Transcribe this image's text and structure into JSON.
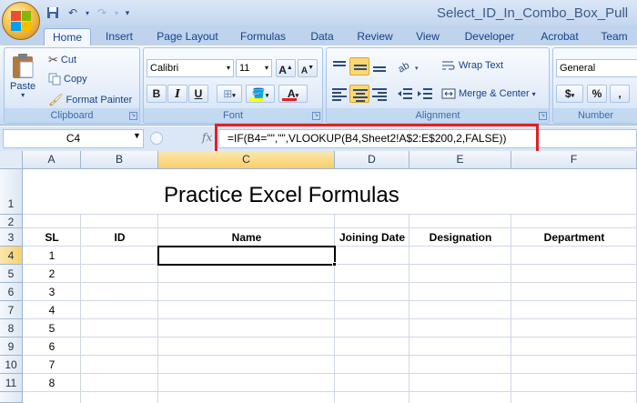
{
  "titlebar": {
    "title": "Select_ID_In_Combo_Box_Pull"
  },
  "ribbon_tabs": [
    "Home",
    "Insert",
    "Page Layout",
    "Formulas",
    "Data",
    "Review",
    "View",
    "Developer",
    "Acrobat",
    "Team"
  ],
  "clipboard": {
    "paste": "Paste",
    "cut": "Cut",
    "copy": "Copy",
    "format_painter": "Format Painter",
    "label": "Clipboard"
  },
  "font": {
    "name": "Calibri",
    "size": "11",
    "grow": "A",
    "shrink": "A",
    "bold": "B",
    "italic": "I",
    "underline": "U",
    "font_color": "A",
    "label": "Font"
  },
  "alignment": {
    "wrap_text": "Wrap Text",
    "merge_center": "Merge & Center",
    "label": "Alignment"
  },
  "number": {
    "format": "General",
    "currency": "$",
    "percent": "%",
    "comma": ",",
    "label": "Number"
  },
  "formula_bar": {
    "name_box": "C4",
    "fx": "fx",
    "formula": "=IF(B4=\"\",\"\",VLOOKUP(B4,Sheet2!A$2:E$200,2,FALSE))"
  },
  "columns": [
    "A",
    "B",
    "C",
    "D",
    "E",
    "F"
  ],
  "rows": [
    "1",
    "2",
    "3",
    "4",
    "5",
    "6",
    "7",
    "8",
    "9",
    "10",
    "11"
  ],
  "sheet": {
    "title": "Practice Excel Formulas",
    "headers": [
      "SL",
      "ID",
      "Name",
      "Joining Date",
      "Designation",
      "Department"
    ],
    "sl": [
      "1",
      "2",
      "3",
      "4",
      "5",
      "6",
      "7",
      "8"
    ]
  },
  "colors": {
    "highlight_box": "#e02020",
    "ribbon_blue": "#15428b",
    "selected_header": "#f8cf6b"
  }
}
